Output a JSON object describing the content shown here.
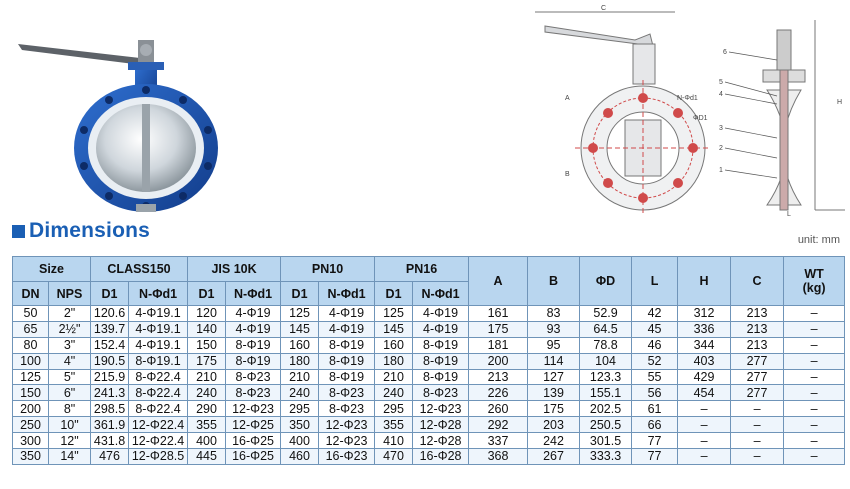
{
  "heading": "Dimensions",
  "unit_note": "unit: mm",
  "drawing_labels": {
    "c": "C",
    "nd1": "N-Φd1",
    "d1": "ΦD1",
    "a": "A",
    "b": "B",
    "h": "H",
    "l": "L",
    "parts": [
      "6",
      "5",
      "4",
      "3",
      "2",
      "1"
    ]
  },
  "table": {
    "size_header": "Size",
    "groups": [
      "CLASS150",
      "JIS 10K",
      "PN10",
      "PN16"
    ],
    "dn": "DN",
    "nps": "NPS",
    "d1": "D1",
    "nd1": "N-Φd1",
    "tail_headers": [
      "A",
      "B",
      "ΦD",
      "L",
      "H",
      "C"
    ],
    "wt_header": [
      "WT",
      "(kg)"
    ],
    "rows": [
      [
        "50",
        "2\"",
        "120.6",
        "4-Φ19.1",
        "120",
        "4-Φ19",
        "125",
        "4-Φ19",
        "125",
        "4-Φ19",
        "161",
        "83",
        "52.9",
        "42",
        "312",
        "213",
        "–"
      ],
      [
        "65",
        "2½\"",
        "139.7",
        "4-Φ19.1",
        "140",
        "4-Φ19",
        "145",
        "4-Φ19",
        "145",
        "4-Φ19",
        "175",
        "93",
        "64.5",
        "45",
        "336",
        "213",
        "–"
      ],
      [
        "80",
        "3\"",
        "152.4",
        "4-Φ19.1",
        "150",
        "8-Φ19",
        "160",
        "8-Φ19",
        "160",
        "8-Φ19",
        "181",
        "95",
        "78.8",
        "46",
        "344",
        "213",
        "–"
      ],
      [
        "100",
        "4\"",
        "190.5",
        "8-Φ19.1",
        "175",
        "8-Φ19",
        "180",
        "8-Φ19",
        "180",
        "8-Φ19",
        "200",
        "114",
        "104",
        "52",
        "403",
        "277",
        "–"
      ],
      [
        "125",
        "5\"",
        "215.9",
        "8-Φ22.4",
        "210",
        "8-Φ23",
        "210",
        "8-Φ19",
        "210",
        "8-Φ19",
        "213",
        "127",
        "123.3",
        "55",
        "429",
        "277",
        "–"
      ],
      [
        "150",
        "6\"",
        "241.3",
        "8-Φ22.4",
        "240",
        "8-Φ23",
        "240",
        "8-Φ23",
        "240",
        "8-Φ23",
        "226",
        "139",
        "155.1",
        "56",
        "454",
        "277",
        "–"
      ],
      [
        "200",
        "8\"",
        "298.5",
        "8-Φ22.4",
        "290",
        "12-Φ23",
        "295",
        "8-Φ23",
        "295",
        "12-Φ23",
        "260",
        "175",
        "202.5",
        "61",
        "–",
        "–",
        "–"
      ],
      [
        "250",
        "10\"",
        "361.9",
        "12-Φ22.4",
        "355",
        "12-Φ25",
        "350",
        "12-Φ23",
        "355",
        "12-Φ28",
        "292",
        "203",
        "250.5",
        "66",
        "–",
        "–",
        "–"
      ],
      [
        "300",
        "12\"",
        "431.8",
        "12-Φ22.4",
        "400",
        "16-Φ25",
        "400",
        "12-Φ23",
        "410",
        "12-Φ28",
        "337",
        "242",
        "301.5",
        "77",
        "–",
        "–",
        "–"
      ],
      [
        "350",
        "14\"",
        "476",
        "12-Φ28.5",
        "445",
        "16-Φ25",
        "460",
        "16-Φ23",
        "470",
        "16-Φ28",
        "368",
        "267",
        "333.3",
        "77",
        "–",
        "–",
        "–"
      ]
    ]
  }
}
